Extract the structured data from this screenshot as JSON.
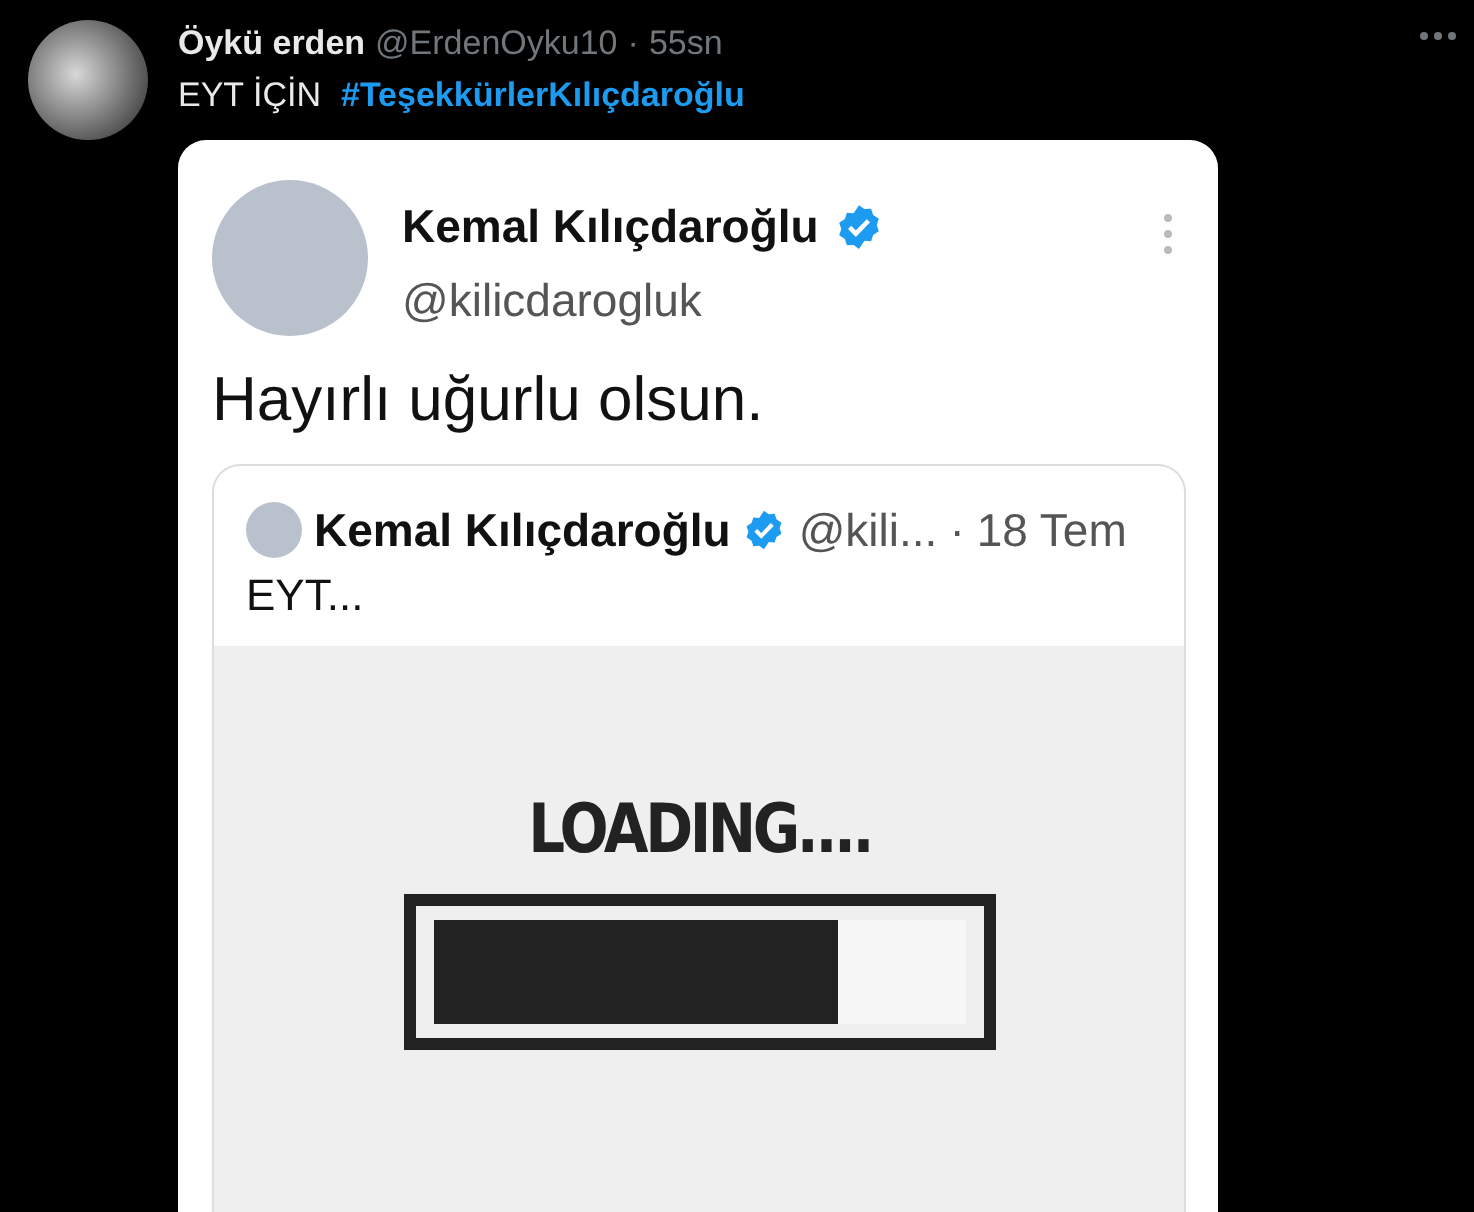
{
  "tweet": {
    "author_name": "Öykü erden",
    "author_handle": "@ErdenOyku10",
    "separator": "·",
    "time": "55sn",
    "text_plain": "EYT İÇİN",
    "hashtag": "#TeşekkürlerKılıçdaroğlu"
  },
  "image": {
    "author_name": "Kemal Kılıçdaroğlu",
    "author_handle": "@kilicdarogluk",
    "text": "Hayırlı uğurlu olsun.",
    "quoted": {
      "author_name": "Kemal Kılıçdaroğlu",
      "author_handle": "@kili...",
      "separator": "·",
      "date": "18 Tem",
      "text": "EYT...",
      "media": {
        "title": "LOADING....",
        "level": 0.76
      }
    }
  }
}
